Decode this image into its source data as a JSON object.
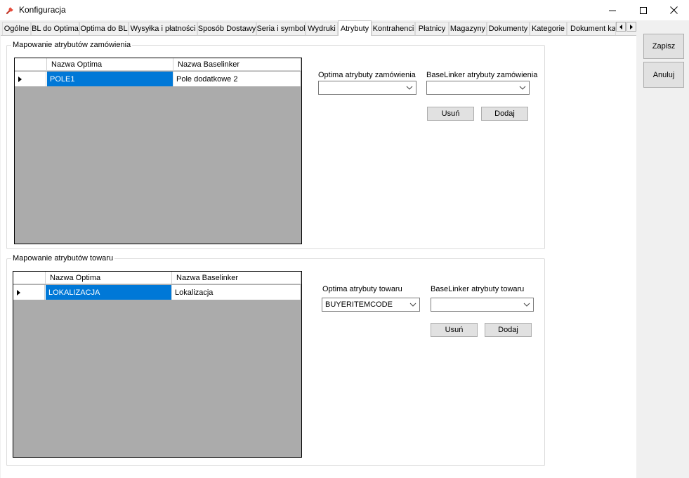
{
  "window": {
    "title": "Konfiguracja",
    "accent_color": "#0078d7"
  },
  "tabs": [
    {
      "label": "Ogólne"
    },
    {
      "label": "BL do Optima"
    },
    {
      "label": "Optima do BL"
    },
    {
      "label": "Wysyłka i płatności"
    },
    {
      "label": "Sposób Dostawy"
    },
    {
      "label": "Seria i symbol"
    },
    {
      "label": "Wydruki"
    },
    {
      "label": "Atrybuty",
      "active": true
    },
    {
      "label": "Kontrahenci"
    },
    {
      "label": "Płatnicy"
    },
    {
      "label": "Magazyny"
    },
    {
      "label": "Dokumenty"
    },
    {
      "label": "Kategorie"
    },
    {
      "label": "Dokument kat"
    }
  ],
  "order_group": {
    "legend": "Mapowanie atrybutów zamówienia",
    "columns": [
      "Nazwa Optima",
      "Nazwa Baselinker"
    ],
    "rows": [
      {
        "optima": "POLE1",
        "baselinker": "Pole dodatkowe 2"
      }
    ],
    "optima_label": "Optima atrybuty zamówienia",
    "optima_value": "",
    "baselinker_label": "BaseLinker atrybuty zamówienia",
    "baselinker_value": "",
    "remove_label": "Usuń",
    "add_label": "Dodaj"
  },
  "product_group": {
    "legend": "Mapowanie atrybutów towaru",
    "columns": [
      "Nazwa Optima",
      "Nazwa Baselinker"
    ],
    "rows": [
      {
        "optima": "LOKALIZACJA",
        "baselinker": "Lokalizacja"
      }
    ],
    "optima_label": "Optima atrybuty towaru",
    "optima_value": "BUYERITEMCODE",
    "baselinker_label": "BaseLinker atrybuty towaru",
    "baselinker_value": "",
    "remove_label": "Usuń",
    "add_label": "Dodaj"
  },
  "actions": {
    "save_label": "Zapisz",
    "cancel_label": "Anuluj"
  }
}
